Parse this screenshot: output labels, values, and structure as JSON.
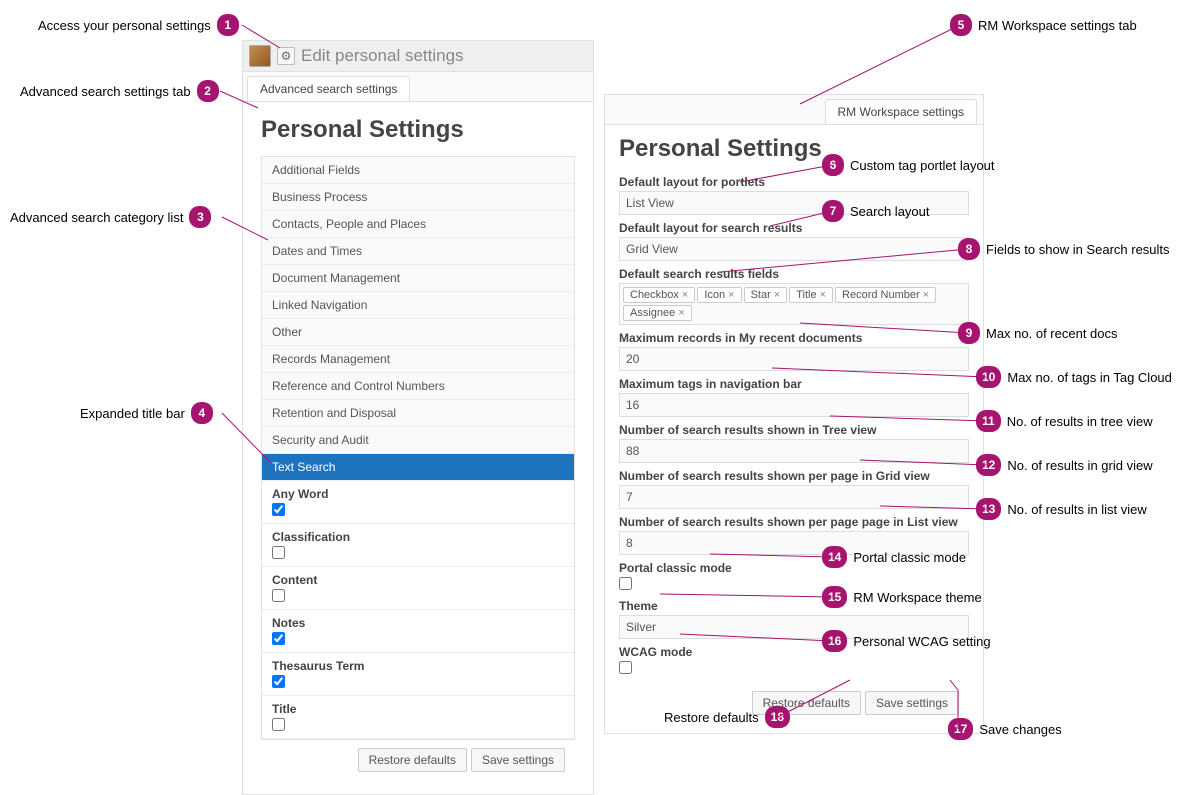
{
  "header": {
    "title": "Edit personal settings",
    "gear_glyph": "⚙"
  },
  "left_panel": {
    "tab_label": "Advanced search settings",
    "heading": "Personal Settings",
    "categories": [
      "Additional Fields",
      "Business Process",
      "Contacts, People and Places",
      "Dates and Times",
      "Document Management",
      "Linked Navigation",
      "Other",
      "Records Management",
      "Reference and Control Numbers",
      "Retention and Disposal",
      "Security and Audit",
      "Text Search"
    ],
    "text_search_options": [
      {
        "label": "Any Word",
        "checked": true
      },
      {
        "label": "Classification",
        "checked": false
      },
      {
        "label": "Content",
        "checked": false
      },
      {
        "label": "Notes",
        "checked": true
      },
      {
        "label": "Thesaurus Term",
        "checked": true
      },
      {
        "label": "Title",
        "checked": false
      }
    ],
    "restore_btn": "Restore defaults",
    "save_btn": "Save settings"
  },
  "right_panel": {
    "tab_label": "RM Workspace settings",
    "heading": "Personal Settings",
    "fields": {
      "portlet_layout_label": "Default layout for portlets",
      "portlet_layout_value": "List View",
      "search_layout_label": "Default layout for search results",
      "search_layout_value": "Grid View",
      "search_fields_label": "Default search results fields",
      "search_fields_chips": [
        "Checkbox",
        "Icon",
        "Star",
        "Title",
        "Record Number",
        "Assignee"
      ],
      "max_recent_label": "Maximum records in My recent documents",
      "max_recent_value": "20",
      "max_tags_label": "Maximum tags in navigation bar",
      "max_tags_value": "16",
      "tree_results_label": "Number of search results shown in Tree view",
      "tree_results_value": "88",
      "grid_results_label": "Number of search results shown per page in Grid view",
      "grid_results_value": "7",
      "list_results_label": "Number of search results shown per page page in List view",
      "list_results_value": "8",
      "portal_classic_label": "Portal classic mode",
      "portal_classic_checked": false,
      "theme_label": "Theme",
      "theme_value": "Silver",
      "wcag_label": "WCAG mode",
      "wcag_checked": false
    },
    "restore_btn": "Restore defaults",
    "save_btn": "Save settings"
  },
  "callouts": {
    "c1": "Access your personal settings",
    "c2": "Advanced search settings tab",
    "c3": "Advanced search category list",
    "c4": "Expanded title bar",
    "c5": "RM Workspace settings tab",
    "c6": "Custom tag portlet layout",
    "c7": "Search layout",
    "c8": "Fields to show in Search results",
    "c9": "Max no. of recent docs",
    "c10": "Max no. of tags in Tag Cloud",
    "c11": "No. of results in tree view",
    "c12": "No. of results in grid view",
    "c13": "No. of results in list view",
    "c14": "Portal classic mode",
    "c15": "RM Workspace theme",
    "c16": "Personal WCAG setting",
    "c17": "Save changes",
    "c18": "Restore defaults"
  }
}
